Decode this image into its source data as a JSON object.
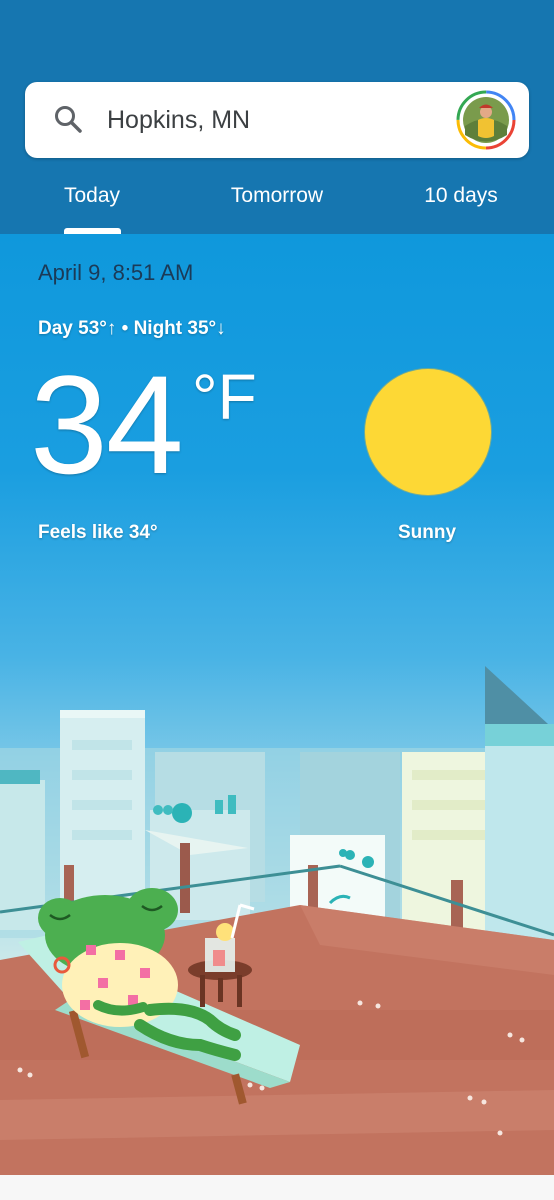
{
  "search": {
    "location": "Hopkins, MN"
  },
  "tabs": [
    {
      "label": "Today",
      "selected": true
    },
    {
      "label": "Tomorrow",
      "selected": false
    },
    {
      "label": "10 days",
      "selected": false
    }
  ],
  "weather": {
    "datetime": "April 9, 8:51 AM",
    "day_night": "Day 53°↑ • Night 35°↓",
    "temperature": "34",
    "unit": "°F",
    "feels_like": "Feels like 34°",
    "condition": "Sunny",
    "icon": "sun-icon"
  },
  "colors": {
    "header": "#1676b0",
    "sky_top": "#0f98dc",
    "sun": "#fdd835",
    "deck": "#c0715f",
    "frog": "#4caf50"
  }
}
